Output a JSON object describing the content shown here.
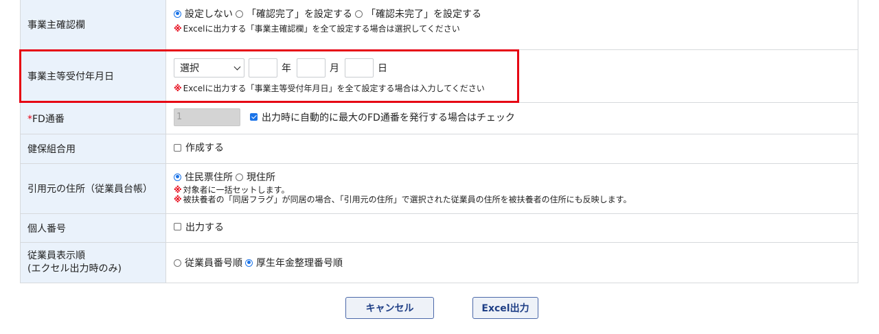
{
  "rows": {
    "owner_confirm": {
      "label": "事業主確認欄",
      "options": [
        "設定しない",
        "「確認完了」を設定する",
        "「確認未完了」を設定する"
      ],
      "note_mark": "※",
      "note": "Excelに出力する「事業主確認欄」を全て設定する場合は選択してください"
    },
    "owner_date": {
      "label": "事業主等受付年月日",
      "era_select": "選択",
      "year_unit": "年",
      "month_unit": "月",
      "day_unit": "日",
      "year_value": "",
      "month_value": "",
      "day_value": "",
      "note_mark": "※",
      "note": "Excelに出力する「事業主等受付年月日」を全て設定する場合は入力してください"
    },
    "fd_serial": {
      "required_mark": "*",
      "label": "FD通番",
      "value": "1",
      "checkbox_label": "出力時に自動的に最大のFD通番を発行する場合はチェック",
      "checked": true
    },
    "health_union": {
      "label": "健保組合用",
      "checkbox_label": "作成する",
      "checked": false
    },
    "address_source": {
      "label": "引用元の住所（従業員台帳）",
      "options": [
        "住民票住所",
        "現住所"
      ],
      "note_mark": "※",
      "note1": "対象者に一括セットします。",
      "note2": "被扶養者の「同居フラグ」が同居の場合、「引用元の住所」で選択された従業員の住所を被扶養者の住所にも反映します。"
    },
    "my_number": {
      "label": "個人番号",
      "checkbox_label": "出力する",
      "checked": false
    },
    "sort_order": {
      "label_line1": "従業員表示順",
      "label_line2": "(エクセル出力時のみ)",
      "options": [
        "従業員番号順",
        "厚生年金整理番号順"
      ]
    }
  },
  "buttons": {
    "cancel": "キャンセル",
    "excel": "Excel出力"
  },
  "colors": {
    "label_bg": "#eaf2fb",
    "accent": "#1a73e8",
    "highlight": "#e60012",
    "button_text": "#1f3f86"
  }
}
